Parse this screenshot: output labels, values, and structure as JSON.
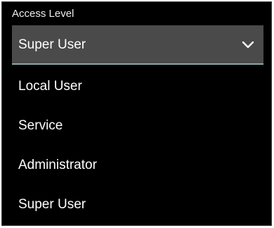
{
  "access_level": {
    "label": "Access Level",
    "selected_value": "Super User",
    "options": [
      "Local User",
      "Service",
      "Administrator",
      "Super User"
    ]
  },
  "icons": {
    "dropdown": "chevron-down-icon"
  },
  "colors": {
    "background": "#000000",
    "select_fill": "#4a4a4a",
    "select_underline": "#8fa6a8",
    "text": "#ffffff"
  }
}
